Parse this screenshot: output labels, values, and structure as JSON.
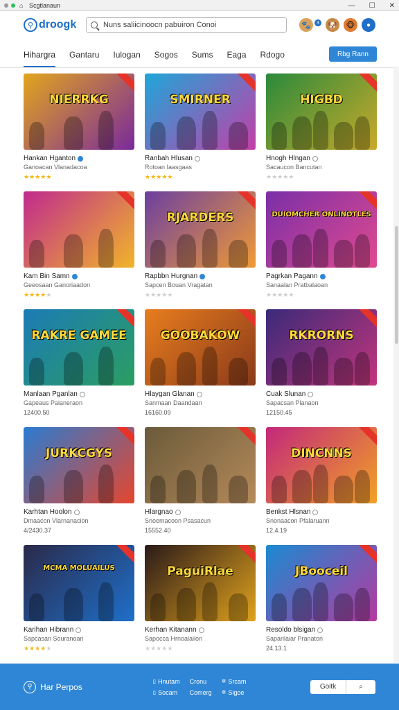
{
  "titlebar": {
    "title": "Scgtlanaun"
  },
  "header": {
    "logo": "droogk",
    "search_placeholder": "Nuns saliicinoocn pabuiron Conoi",
    "badge_count": "3"
  },
  "nav": {
    "tabs": [
      "Hihargra",
      "Gantaru",
      "Iulogan",
      "Sogos",
      "Sums",
      "Eaga",
      "Rdogo"
    ],
    "button": "Rbg Rann"
  },
  "cards": [
    {
      "title": "Hankan Hganton",
      "sub": "Ganoacan Vlanadacoa",
      "rating": 5,
      "count": "",
      "verified": "blue",
      "art": "NIERRKG",
      "c1": "#e2a51c",
      "c2": "#7a2a9c"
    },
    {
      "title": "Ranbah Hlusan",
      "sub": "Rotoan Iaasgaas",
      "rating": 5,
      "count": "",
      "verified": "grey",
      "art": "SMIRNER",
      "c1": "#1ea6d8",
      "c2": "#c33fa8"
    },
    {
      "title": "Hnogh Hlngan",
      "sub": "Sacaucon Bancutan",
      "rating": 0,
      "count": "",
      "verified": "grey",
      "art": "HIGBD",
      "c1": "#2a8a3b",
      "c2": "#c8a92a"
    },
    {
      "title": "Kam Bin Samn",
      "sub": "Geeosaan Ganoriaadon",
      "rating": 4,
      "count": "",
      "verified": "blue",
      "art": "",
      "c1": "#c02a8e",
      "c2": "#f0b52a"
    },
    {
      "title": "Rapbbn Hurgnan",
      "sub": "Sapcen Bouan Vragatan",
      "rating": 0,
      "count": "",
      "verified": "blue",
      "art": "RJARDERS",
      "c1": "#6b3fa0",
      "c2": "#f09a36"
    },
    {
      "title": "Pagrkan Pagann",
      "sub": "Sanaalan Pratbalaoan",
      "rating": 0,
      "count": "",
      "verified": "blue",
      "art": "DUIOMCHER ONLINOTLES",
      "c1": "#7a2fa8",
      "c2": "#e04a8f"
    },
    {
      "title": "Manlaan Pganlan",
      "sub": "Gapeaus Paianeraon",
      "rating": 0,
      "count": "12400.50",
      "verified": "grey",
      "art": "RAKRE GAMEE",
      "c1": "#1b7bb5",
      "c2": "#2b9e62"
    },
    {
      "title": "Hlaygan Glanan",
      "sub": "Sanmaan Daandaan",
      "rating": 0,
      "count": "16160.09",
      "verified": "grey",
      "art": "GOOBAKOW",
      "c1": "#e87d1e",
      "c2": "#8a3a1a"
    },
    {
      "title": "Cuak Slunan",
      "sub": "Sapacsan Planaon",
      "rating": 0,
      "count": "12150.45",
      "verified": "grey",
      "art": "RKRORNS",
      "c1": "#3a2a7a",
      "c2": "#c2357b"
    },
    {
      "title": "Karhtan Hoolon",
      "sub": "Dmaacon Vlarnanacion",
      "rating": 0,
      "count": "4/2430.37",
      "verified": "grey",
      "art": "JURKCGYS",
      "c1": "#2b7bd1",
      "c2": "#e5462e"
    },
    {
      "title": "Hlargnao",
      "sub": "Snoemacoon Psasacun",
      "rating": 0,
      "count": "15552.40",
      "verified": "grey",
      "art": "",
      "c1": "#6a5a3a",
      "c2": "#b58a5a"
    },
    {
      "title": "Benkst Hlsnan",
      "sub": "Snonaacon Pfalaruann",
      "rating": 0,
      "count": "12.4.19",
      "verified": "grey",
      "art": "DINCNNS",
      "c1": "#c2287b",
      "c2": "#f2a125"
    },
    {
      "title": "Karihan Hibrann",
      "sub": "Sapcasan Souranoan",
      "rating": 4,
      "count": "",
      "verified": "grey",
      "art": "MCMA MOLUAILUS",
      "c1": "#2a2a4a",
      "c2": "#1f6fc9"
    },
    {
      "title": "Kerhan Kitanann",
      "sub": "Sapocca Hrnoalaiion",
      "rating": 0,
      "count": "",
      "verified": "grey",
      "art": "PaguiRlae",
      "c1": "#2a1a1a",
      "c2": "#e0a21c"
    },
    {
      "title": "Resoldo blsigan",
      "sub": "Saparilaiar Pranaton",
      "rating": 0,
      "count": "24.13.1",
      "verified": "grey",
      "art": "JBooceil",
      "c1": "#1a8ad1",
      "c2": "#b53aa0"
    }
  ],
  "footer": {
    "brand": "Har Perpos",
    "links": [
      "Hnutam",
      "Cronu",
      "Srcam",
      "Socam",
      "Comerg",
      "Sigoe"
    ],
    "go_button": "Goitk",
    "colors": {
      "bar": "#2f86d6"
    }
  },
  "colors": {
    "accent": "#1f6fc9",
    "star": "#f3b815",
    "ribbon": "#e5332a"
  }
}
